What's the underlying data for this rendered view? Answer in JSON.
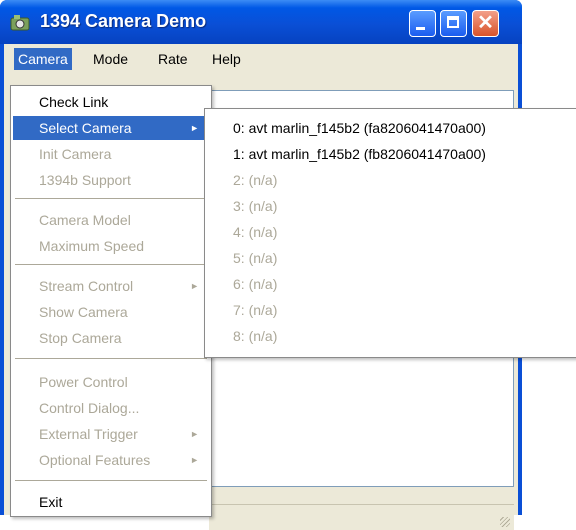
{
  "window": {
    "title": "1394 Camera Demo",
    "icon": "camera-app-icon",
    "close_glyph": "✕"
  },
  "menubar": {
    "items": [
      "Camera",
      "Mode",
      "Rate",
      "Help"
    ]
  },
  "camera_menu": {
    "items": [
      {
        "label": "Check Link",
        "enabled": true
      },
      {
        "label": "Select Camera",
        "enabled": true,
        "submenu": true,
        "arrow": "►"
      },
      {
        "label": "Init Camera",
        "enabled": false
      },
      {
        "label": "1394b Support",
        "enabled": false
      },
      {
        "label": "Camera Model",
        "enabled": false
      },
      {
        "label": "Maximum Speed",
        "enabled": false
      },
      {
        "label": "Stream Control",
        "enabled": false,
        "submenu": true,
        "arrow": "►"
      },
      {
        "label": "Show Camera",
        "enabled": false
      },
      {
        "label": "Stop Camera",
        "enabled": false
      },
      {
        "label": "Power Control",
        "enabled": false
      },
      {
        "label": "Control Dialog...",
        "enabled": false
      },
      {
        "label": "External Trigger",
        "enabled": false,
        "submenu": true,
        "arrow": "►"
      },
      {
        "label": "Optional Features",
        "enabled": false,
        "submenu": true,
        "arrow": "►"
      },
      {
        "label": "Exit",
        "enabled": true
      }
    ]
  },
  "select_camera_submenu": {
    "items": [
      {
        "label": "0: avt marlin_f145b2 (fa8206041470a00)",
        "enabled": true
      },
      {
        "label": "1: avt marlin_f145b2 (fb8206041470a00)",
        "enabled": true
      },
      {
        "label": "2: (n/a)",
        "enabled": false
      },
      {
        "label": "3: (n/a)",
        "enabled": false
      },
      {
        "label": "4: (n/a)",
        "enabled": false
      },
      {
        "label": "5: (n/a)",
        "enabled": false
      },
      {
        "label": "6: (n/a)",
        "enabled": false
      },
      {
        "label": "7: (n/a)",
        "enabled": false
      },
      {
        "label": "8: (n/a)",
        "enabled": false
      }
    ]
  },
  "colors": {
    "title_bar": "#0a4fd6",
    "highlight": "#316ac5",
    "disabled_text": "#aca899",
    "close_button": "#d8532a"
  }
}
